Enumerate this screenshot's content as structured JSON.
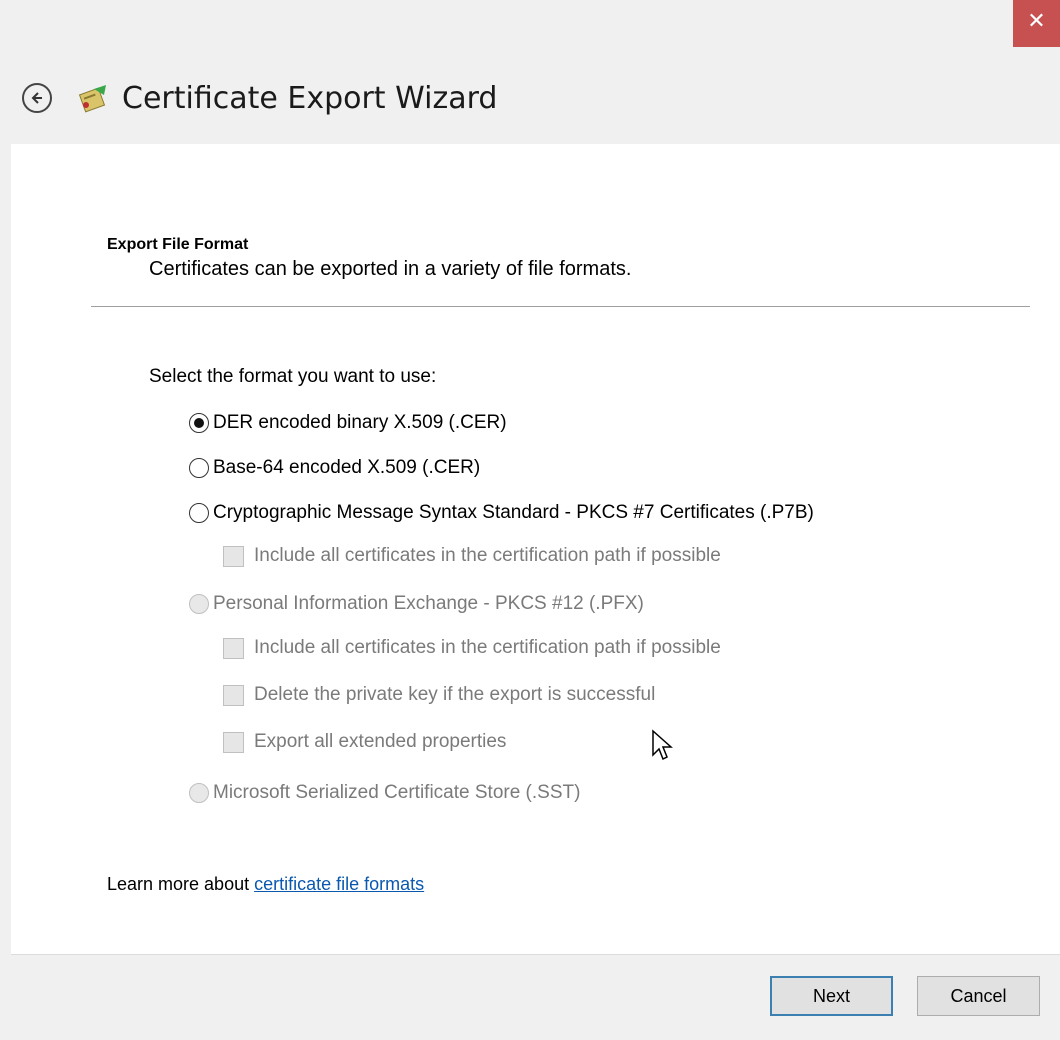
{
  "window": {
    "close_glyph": "✕",
    "title": "Certificate Export Wizard"
  },
  "section": {
    "title": "Export File Format",
    "subtitle": "Certificates can be exported in a variety of file formats."
  },
  "prompt": "Select the format you want to use:",
  "options": [
    {
      "label": "DER encoded binary X.509 (.CER)",
      "selected": true,
      "enabled": true
    },
    {
      "label": "Base-64 encoded X.509 (.CER)",
      "selected": false,
      "enabled": true
    },
    {
      "label": "Cryptographic Message Syntax Standard - PKCS #7 Certificates (.P7B)",
      "selected": false,
      "enabled": true
    },
    {
      "label": "Personal Information Exchange - PKCS #12 (.PFX)",
      "selected": false,
      "enabled": false
    },
    {
      "label": "Microsoft Serialized Certificate Store (.SST)",
      "selected": false,
      "enabled": false
    }
  ],
  "checkboxes": [
    {
      "label": "Include all certificates in the certification path if possible",
      "checked": false,
      "enabled": false
    },
    {
      "label": "Include all certificates in the certification path if possible",
      "checked": false,
      "enabled": false
    },
    {
      "label": "Delete the private key if the export is successful",
      "checked": false,
      "enabled": false
    },
    {
      "label": "Export all extended properties",
      "checked": false,
      "enabled": false
    }
  ],
  "learn_more": {
    "prefix": "Learn more about ",
    "link": "certificate file formats"
  },
  "buttons": {
    "next": "Next",
    "cancel": "Cancel"
  },
  "colors": {
    "close_bg": "#c75050",
    "link": "#0a58b0",
    "primary_border": "#3c7fb1"
  }
}
